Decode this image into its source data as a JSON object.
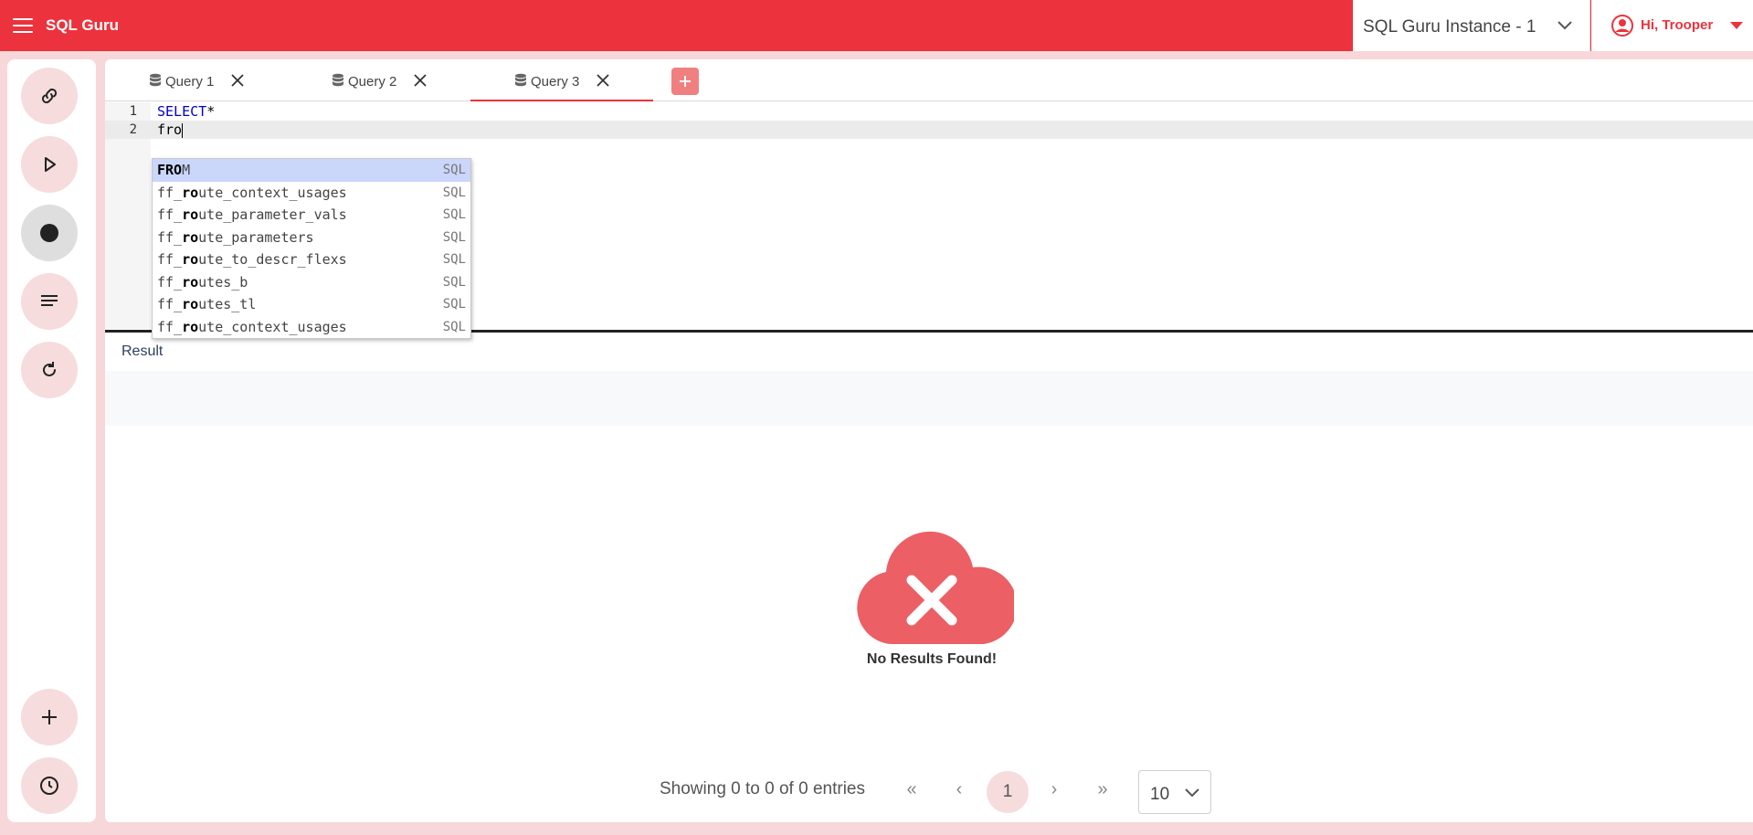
{
  "header": {
    "app_title": "SQL Guru",
    "instance_label": "SQL Guru Instance - 1",
    "user_greeting": "Hi, Trooper",
    "accent_color": "#ec323c"
  },
  "sidebar": {
    "buttons": [
      {
        "name": "connect",
        "icon": "link-icon"
      },
      {
        "name": "run",
        "icon": "play-icon"
      },
      {
        "name": "stop",
        "icon": "record-icon"
      },
      {
        "name": "format",
        "icon": "align-left-icon"
      },
      {
        "name": "refresh",
        "icon": "refresh-icon"
      },
      {
        "name": "add",
        "icon": "plus-icon"
      },
      {
        "name": "history",
        "icon": "clock-icon"
      }
    ]
  },
  "tabs": [
    {
      "label": "Query 1",
      "active": false
    },
    {
      "label": "Query 2",
      "active": false
    },
    {
      "label": "Query 3",
      "active": true
    }
  ],
  "editor": {
    "lines": [
      {
        "number": "1",
        "keyword": "SELECT",
        "rest": "*"
      },
      {
        "number": "2",
        "text": "fro"
      }
    ]
  },
  "autocomplete": {
    "items": [
      {
        "match": "FRO",
        "rest": "M",
        "meta": "SQL"
      },
      {
        "prefix": "ff_",
        "match": "ro",
        "rest": "ute_context_usages",
        "meta": "SQL"
      },
      {
        "prefix": "ff_",
        "match": "ro",
        "rest": "ute_parameter_vals",
        "meta": "SQL"
      },
      {
        "prefix": "ff_",
        "match": "ro",
        "rest": "ute_parameters",
        "meta": "SQL"
      },
      {
        "prefix": "ff_",
        "match": "ro",
        "rest": "ute_to_descr_flexs",
        "meta": "SQL"
      },
      {
        "prefix": "ff_",
        "match": "ro",
        "rest": "utes_b",
        "meta": "SQL"
      },
      {
        "prefix": "ff_",
        "match": "ro",
        "rest": "utes_tl",
        "meta": "SQL"
      },
      {
        "prefix": "ff_",
        "match": "ro",
        "rest": "ute_context_usages",
        "meta": "SQL"
      }
    ]
  },
  "result": {
    "title": "Result",
    "empty_message": "No Results Found!"
  },
  "pagination": {
    "info": "Showing 0 to 0 of 0 entries",
    "first": "«",
    "prev": "‹",
    "current_page": "1",
    "next": "›",
    "last": "»",
    "page_size": "10"
  }
}
